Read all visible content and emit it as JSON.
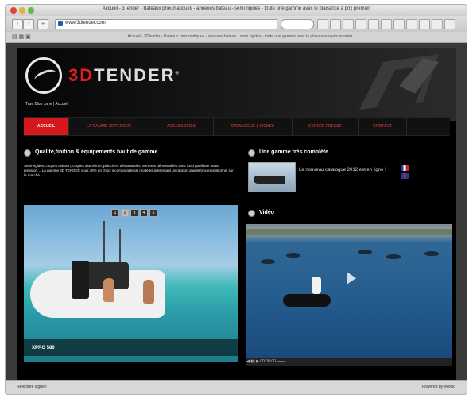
{
  "window": {
    "title": "Accueil - 3Tender - Bateaux pneumatiques - annexes bateau - semi rigides - toute une gamme avec le plaisance a prix premier"
  },
  "browser": {
    "url": "www.3dtender.com",
    "bookmarks_text": "Accueil - 3Dtender - Bateaux pneumatiques - annexes bateau - semi rigides - toute une gamme avec le plaisance a prix premier",
    "status_left": "Relecture signée",
    "status_right": "Powered by ekoslo"
  },
  "site": {
    "brand_prefix": "3D",
    "brand_suffix": "TENDER",
    "brand_mark": "®",
    "tagline": "True Blue Jane | Accueil",
    "menu": [
      {
        "label": "Accueil",
        "active": true
      },
      {
        "label": "LA GAMME 3D TENDER",
        "active": false
      },
      {
        "label": "ACCESSOIRES",
        "active": false
      },
      {
        "label": "Catalogue & Fiches",
        "active": false
      },
      {
        "label": "ESPACE PRESSE",
        "active": false
      },
      {
        "label": "CONTACT",
        "active": false
      }
    ],
    "section_quality": {
      "title": "Qualité,finition & équipements haut de gamme",
      "text": "Semi-rigides, coques aviation, coques aluminium, planchers démontables, annexes démontables avec fond gonflable haute pression… La gamme 3D TENDER vous offre un choix incomparable de modèles présentant un rapport qualité/prix exceptionnel sur le marché !"
    },
    "slider": {
      "caption": "XPRO 580",
      "pages": [
        "1",
        "2",
        "3",
        "4",
        "5"
      ],
      "current_page": 2
    },
    "section_range": {
      "title": "Une gamme très complète",
      "promo_text": "Le nouveau catalogue 2012 est en ligne !"
    },
    "section_video": {
      "title": "Vidéo",
      "controls": "◀ ▮▮ ▶  00:00:00  ▬▬"
    }
  }
}
